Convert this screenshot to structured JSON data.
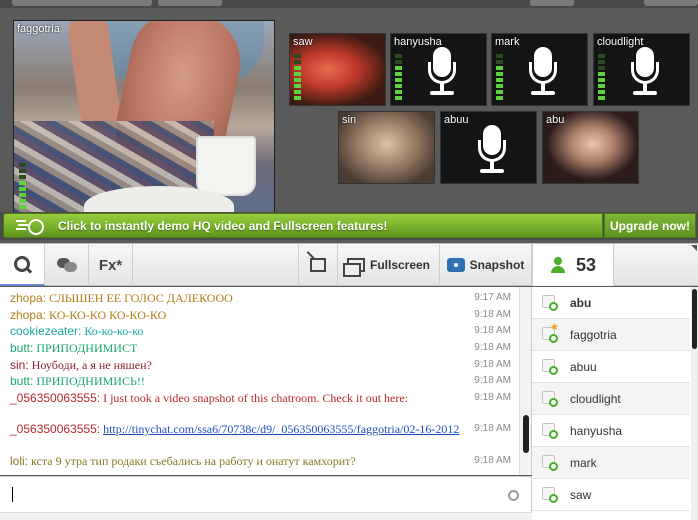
{
  "main_cam": {
    "label": "faggotria",
    "meter_level": 0.6
  },
  "tiles": [
    {
      "label": "saw",
      "type": "video",
      "meter_level": 0.8
    },
    {
      "label": "hanyusha",
      "type": "mic",
      "meter_level": 0.7
    },
    {
      "label": "mark",
      "type": "mic",
      "meter_level": 0.7
    },
    {
      "label": "cloudlight",
      "type": "mic",
      "meter_level": 0.6
    },
    {
      "label": "sin",
      "type": "video",
      "meter_level": 0
    },
    {
      "label": "abuu",
      "type": "mic",
      "meter_level": 0
    },
    {
      "label": "abu",
      "type": "video",
      "meter_level": 0
    }
  ],
  "promo": {
    "text": "Click to instantly demo HQ video and Fullscreen features!",
    "upgrade_label": "Upgrade now!"
  },
  "toolbar": {
    "zoom_icon": "magnifier-icon",
    "chat_icon": "chat-bubbles-icon",
    "fx_label": "Fx*",
    "popout_icon": "popout-icon",
    "fullscreen_label": "Fullscreen",
    "snapshot_label": "Snapshot",
    "user_count": "53"
  },
  "chat": [
    {
      "nick": "zhopa:",
      "text": " СЛЫШЕН ЕЕ ГОЛОС ДАЛЕКООО",
      "time": "9:17 AM",
      "style": "c-zhopa"
    },
    {
      "nick": "zhopa:",
      "text": " КО-КО-КО КО-КО-КО",
      "time": "9:18 AM",
      "style": "c-zhopa"
    },
    {
      "nick": "cookiezeater:",
      "text": " Ко-ко-ко-ко",
      "time": "9:18 AM",
      "style": "c-cookie"
    },
    {
      "nick": "butt:",
      "text": " ПРИПОДНИМИСТ",
      "time": "9:18 AM",
      "style": "c-butt"
    },
    {
      "nick": "sin:",
      "text": " Ноубоди, а я не няшен?",
      "time": "9:18 AM",
      "style": "c-sin"
    },
    {
      "nick": "butt:",
      "text": " ПРИПОДНИМИСЬ!!",
      "time": "9:18 AM",
      "style": "c-butt"
    },
    {
      "nick": "_056350063555:",
      "text": " I just took a video snapshot of this chatroom. Check it out here:",
      "time": "9:18 AM",
      "style": "c-snap"
    },
    {
      "nick": "_056350063555:",
      "text": " ",
      "link": "http://tinychat.com/ssa6/70738c/d9/_056350063555/faggotria/02-16-2012",
      "time": "9:18 AM",
      "style": "c-snap"
    },
    {
      "nick": "loli:",
      "text": " кста 9 утра тип родаки съебались на работу и онатут камхорит?",
      "time": "9:18 AM",
      "style": "c-loli"
    }
  ],
  "input": {
    "placeholder": "",
    "value": ""
  },
  "users": [
    {
      "name": "abu",
      "bold": true,
      "star": false
    },
    {
      "name": "faggotria",
      "bold": false,
      "star": true
    },
    {
      "name": "abuu",
      "bold": false,
      "star": false
    },
    {
      "name": "cloudlight",
      "bold": false,
      "star": false
    },
    {
      "name": "hanyusha",
      "bold": false,
      "star": false
    },
    {
      "name": "mark",
      "bold": false,
      "star": false
    },
    {
      "name": "saw",
      "bold": false,
      "star": false
    }
  ],
  "colors": {
    "accent_green": "#78b02a",
    "user_online": "#43b02a",
    "link": "#1f4fbf"
  }
}
